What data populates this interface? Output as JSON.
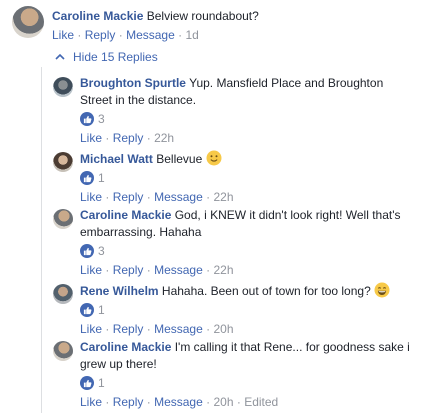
{
  "top_comment": {
    "author": "Caroline Mackie",
    "text": "Belview roundabout?",
    "actions": {
      "like": "Like",
      "reply": "Reply",
      "message": "Message",
      "time": "1d"
    }
  },
  "hide_replies_label": "Hide 15 Replies",
  "replies": [
    {
      "author": "Broughton Spurtle",
      "text_line1": "Yup. Mansfield Place and Broughton",
      "text_line2": "Street in the distance.",
      "reactions": "3",
      "actions": {
        "like": "Like",
        "reply": "Reply",
        "time": "22h"
      }
    },
    {
      "author": "Michael Watt",
      "text": "Bellevue",
      "emoji": "slight-smile-emoji",
      "reactions": "1",
      "actions": {
        "like": "Like",
        "reply": "Reply",
        "message": "Message",
        "time": "22h"
      }
    },
    {
      "author": "Caroline Mackie",
      "text_line1": "God, i KNEW it didn't look right! Well that's",
      "text_line2": "embarrassing. Hahaha",
      "reactions": "3",
      "actions": {
        "like": "Like",
        "reply": "Reply",
        "message": "Message",
        "time": "22h"
      }
    },
    {
      "author": "Rene Wilhelm",
      "text": "Hahaha. Been out of town for too long?",
      "emoji": "grin-emoji",
      "reactions": "1",
      "actions": {
        "like": "Like",
        "reply": "Reply",
        "message": "Message",
        "time": "20h"
      }
    },
    {
      "author": "Caroline Mackie",
      "text_line1": "I'm calling it that Rene... for goodness sake i",
      "text_line2": "grew up there!",
      "reactions": "1",
      "actions": {
        "like": "Like",
        "reply": "Reply",
        "message": "Message",
        "time": "20h",
        "edited": "Edited"
      }
    }
  ],
  "colors": {
    "link": "#365899",
    "action": "#4267b2",
    "meta": "#90949c",
    "like_badge": "#4267b2"
  }
}
